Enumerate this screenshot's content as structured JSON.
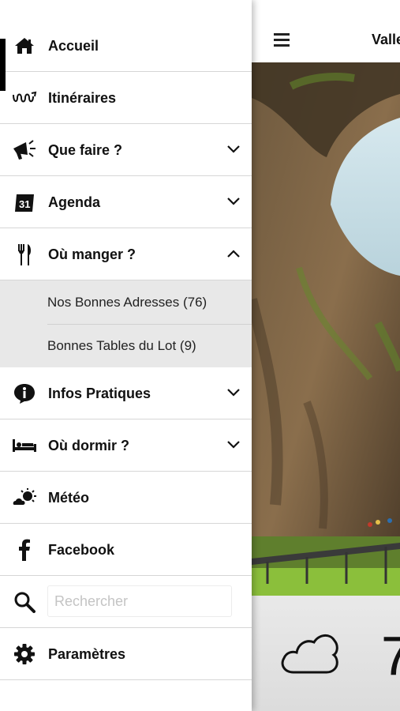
{
  "header": {
    "title": "Valle"
  },
  "menu": {
    "items": [
      {
        "label": "Accueil",
        "icon": "home-icon"
      },
      {
        "label": "Itinéraires",
        "icon": "route-icon"
      },
      {
        "label": "Que faire ?",
        "icon": "megaphone-icon"
      },
      {
        "label": "Agenda",
        "icon": "calendar-icon",
        "badge": "31"
      },
      {
        "label": "Où manger ?",
        "icon": "cutlery-icon"
      },
      {
        "label": "Infos Pratiques",
        "icon": "info-icon"
      },
      {
        "label": "Où dormir ?",
        "icon": "bed-icon"
      },
      {
        "label": "Météo",
        "icon": "weather-icon"
      },
      {
        "label": "Facebook",
        "icon": "facebook-icon"
      },
      {
        "label": "Paramètres",
        "icon": "gear-icon"
      }
    ],
    "sub_items": [
      {
        "label": "Nos Bonnes Adresses (76)"
      },
      {
        "label": "Bonnes Tables du Lot (9)"
      }
    ]
  },
  "search": {
    "placeholder": "Rechercher",
    "value": ""
  },
  "weather": {
    "temp": "7",
    "icon": "cloud-icon"
  },
  "colors": {
    "accent": "#000000",
    "submenu_bg": "#e8e8e8",
    "divider": "#d6d6d6"
  }
}
